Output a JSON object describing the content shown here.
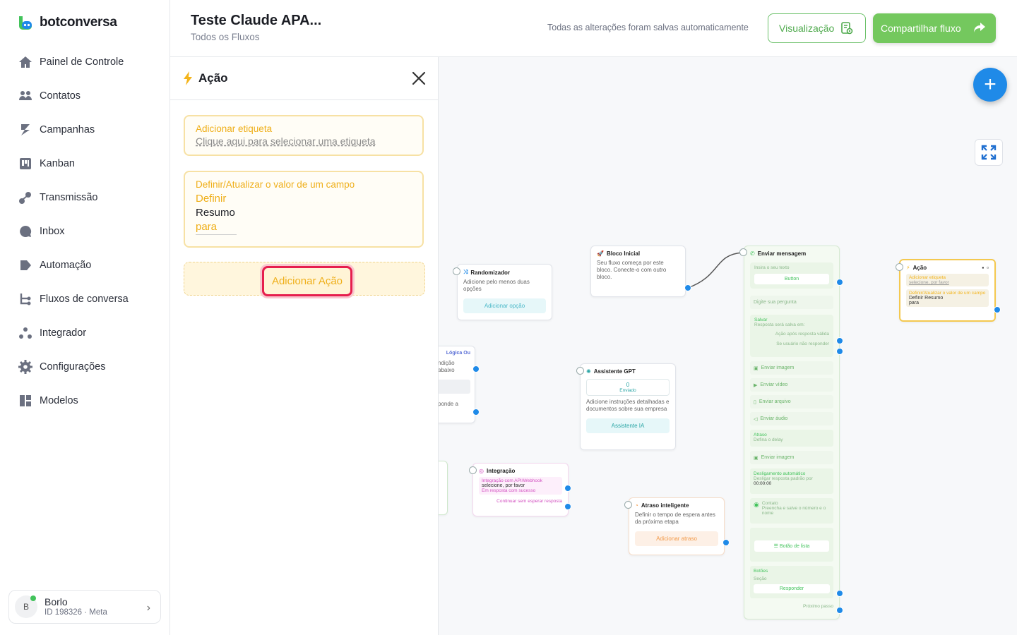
{
  "brand": {
    "name": "botconversa",
    "color": "#1f8ae8"
  },
  "nav": [
    {
      "label": "Painel de Controle",
      "icon": "home-icon"
    },
    {
      "label": "Contatos",
      "icon": "users-icon"
    },
    {
      "label": "Campanhas",
      "icon": "campaign-icon"
    },
    {
      "label": "Kanban",
      "icon": "kanban-icon"
    },
    {
      "label": "Transmissão",
      "icon": "broadcast-icon"
    },
    {
      "label": "Inbox",
      "icon": "chat-icon"
    },
    {
      "label": "Automação",
      "icon": "automation-icon"
    },
    {
      "label": "Fluxos de conversa",
      "icon": "flow-icon"
    },
    {
      "label": "Integrador",
      "icon": "integrator-icon"
    },
    {
      "label": "Configurações",
      "icon": "gear-icon"
    },
    {
      "label": "Modelos",
      "icon": "templates-icon"
    }
  ],
  "account": {
    "initial": "B",
    "name": "Borlo",
    "id": "ID 198326 · Meta"
  },
  "header": {
    "title": "Teste Claude APA...",
    "subtitle": "Todos os Fluxos",
    "saved": "Todas as alterações foram salvas automaticamente",
    "view_btn": "Visualização",
    "share_btn": "Compartilhar fluxo"
  },
  "panel": {
    "title": "Ação",
    "tag_card": {
      "title": "Adicionar etiqueta",
      "link": "Clique aqui para selecionar uma etiqueta"
    },
    "field_card": {
      "title": "Definir/Atualizar o valor de um campo",
      "define": "Definir",
      "field": "Resumo",
      "to": "para"
    },
    "add_action": "Adicionar Ação"
  },
  "canvas": {
    "randomizer": {
      "title": "Randomizador",
      "desc": "Adicione pelo menos duas opções",
      "btn": "Adicionar opção"
    },
    "start": {
      "title": "Bloco Inicial",
      "desc": "Seu fluxo começa por este bloco. Conecte-o com outro bloco."
    },
    "logic": {
      "tag": "Lógica Ou",
      "line1": "ndição abaixo",
      "line2": "ponde a"
    },
    "gpt": {
      "title": "Assistente GPT",
      "count": "0",
      "count_label": "Enviado",
      "desc": "Adicione instruções detalhadas e documentos sobre sua empresa",
      "btn": "Assistente IA"
    },
    "integration": {
      "title": "Integração",
      "tag": "Integração com API/Webhook",
      "value": "selecione, por favor",
      "status": "Em resposta com sucesso",
      "continue": "Continuar sem esperar resposta"
    },
    "delay": {
      "title": "Atraso inteligente",
      "desc": "Definir o tempo de espera antes da próxima etapa",
      "btn": "Adicionar atraso"
    },
    "send": {
      "title": "Enviar mensagem",
      "input_label": "Insira o seu texto",
      "button": "Button",
      "question": "Digite sua pergunta",
      "save_title": "Salvar",
      "save_desc": "Resposta será salva em:",
      "after_valid": "Ação após resposta válida",
      "no_reply": "Se usuário não responder",
      "image": "Enviar imagem",
      "video": "Enviar vídeo",
      "file": "Enviar arquivo",
      "audio": "Enviar áudio",
      "delay_title": "Atraso",
      "delay_desc": "Defina o delay",
      "image2": "Enviar imagem",
      "auto_title": "Desligamento automático",
      "auto_desc": "Desligar resposta padrão por",
      "auto_time": "00:00:00",
      "contact_title": "Contato",
      "contact_desc": "Preencha e salve o número e o nome",
      "list_btn": "Botão de lista",
      "buttons_title": "Botões",
      "section": "Seção",
      "reply": "Responder",
      "next": "Próximo passo"
    },
    "action_node": {
      "title": "Ação",
      "tag": "Adicionar etiqueta",
      "tag_val": "selecione, por favor",
      "field": "Definir/Atualizar o valor de um campo",
      "line1": "Definir Resumo",
      "line2": "para"
    }
  }
}
